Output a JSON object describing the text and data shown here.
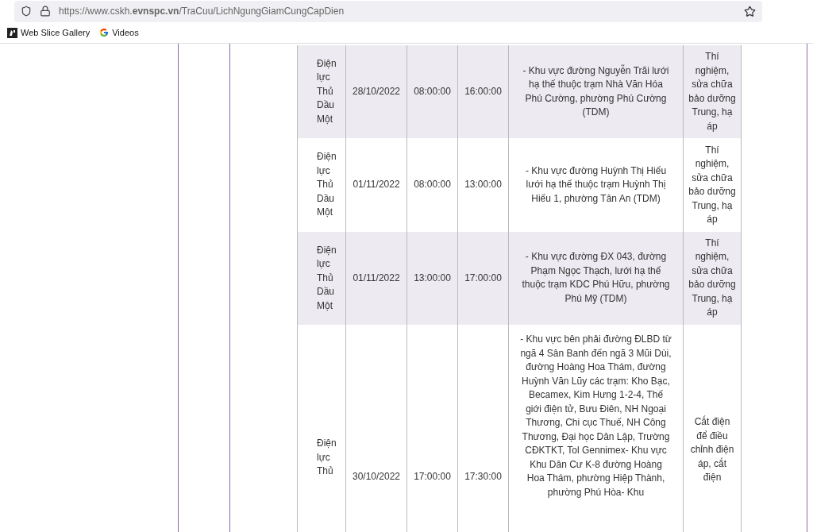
{
  "browser": {
    "url": "https://www.cskh.**evnspc.vn**/TraCuu/LichNgungGiamCungCapDien",
    "bookmarks": [
      {
        "label": "Web Slice Gallery",
        "kind": "slice"
      },
      {
        "label": "Videos",
        "kind": "google"
      }
    ]
  },
  "table": {
    "rows": [
      {
        "unit": "Điện lực Thủ Dầu Một",
        "date": "28/10/2022",
        "start": "08:00:00",
        "end": "16:00:00",
        "description": "- Khu vực đường Nguyễn Trãi lưới hạ thế thuộc trạm Nhà Văn Hóa Phú Cường, phường Phú Cường (TDM)",
        "reason": "Thí nghiệm, sửa chữa bảo dưỡng Trung, hạ áp"
      },
      {
        "unit": "Điện lực Thủ Dầu Một",
        "date": "01/11/2022",
        "start": "08:00:00",
        "end": "13:00:00",
        "description": "- Khu vực đường Huỳnh Thị Hiếu lưới hạ thế thuộc trạm Huỳnh Thị Hiếu 1, phường Tân An (TDM)",
        "reason": "Thí nghiệm, sửa chữa bảo dưỡng Trung, hạ áp"
      },
      {
        "unit": "Điện lực Thủ Dầu Một",
        "date": "01/11/2022",
        "start": "13:00:00",
        "end": "17:00:00",
        "description": "- Khu vực đường ĐX 043, đường Phạm Ngọc Thạch, lưới hạ thế thuộc trạm KDC Phú Hữu, phường Phú Mỹ (TDM)",
        "reason": "Thí nghiệm, sửa chữa bảo dưỡng Trung, hạ áp"
      },
      {
        "unit": "Điện lực Thủ",
        "date": "30/10/2022",
        "start": "17:00:00",
        "end": "17:30:00",
        "description": "- Khu vực bên phải đường ĐLBD từ ngã 4 Sân Banh đến ngã 3 Mũi Dùi, đường Hoàng Hoa Thám, đường Huỳnh Văn Lũy các trạm: Kho Bạc, Becamex, Kim Hưng 1-2-4, Thế giới điện tử, Bưu Điên, NH Ngoại Thương, Chi cục Thuế, NH Công Thương, Đại học Dân Lập, Trường CĐKTKT, Tol Gennimex- Khu vực Khu Dân Cư K-8 đường Hoàng Hoa Thám, phường Hiệp Thành, phường Phú Hòa- Khu",
        "reason": "Cắt điện để điều chỉnh điện áp, cắt điện"
      }
    ]
  }
}
